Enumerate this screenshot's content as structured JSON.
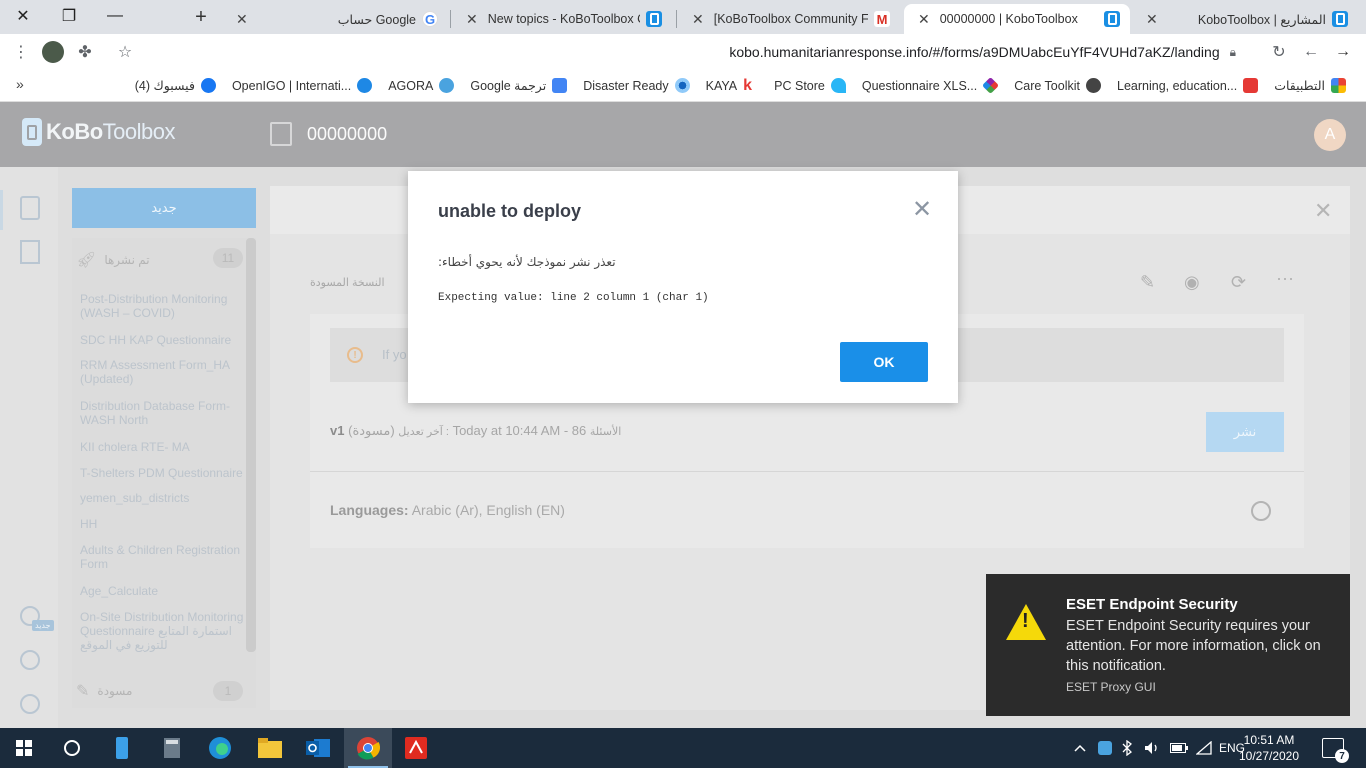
{
  "browser": {
    "tabs": [
      {
        "title": "حساب Google",
        "favicon": "google-icon"
      },
      {
        "title": "New topics - KoBoToolbox Con",
        "favicon": "kobo-icon"
      },
      {
        "title": "[KoBoToolbox Community Foru",
        "favicon": "gmail-icon"
      },
      {
        "title": "00000000 | KoboToolbox",
        "favicon": "kobo-icon",
        "active": true
      },
      {
        "title": "KoboToolbox | المشاريع",
        "favicon": "kobo-icon"
      }
    ],
    "url": "kobo.humanitarianresponse.info/#/forms/a9DMUabcEuYfF4VUHd7aKZ/landing",
    "bookmarks": [
      "التطبيقات",
      "Learning, education...",
      "Care Toolkit",
      "Questionnaire XLS...",
      "PC Store",
      "KAYA",
      "Disaster Ready",
      "Google ترجمة",
      "AGORA",
      "OpenIGO | Internati...",
      "(4) فيسبوك"
    ],
    "more_label": "»"
  },
  "app": {
    "logo_bold": "KoBo",
    "logo_light": "Toolbox",
    "form_title": "00000000",
    "user_initial": "A",
    "new_button": "جديد",
    "sidebar": {
      "deployed_header": "تم نشرها",
      "deployed_count": "11",
      "items": [
        "Post-Distribution Monitoring (WASH – COVID)",
        "SDC HH KAP Questionnaire",
        "RRM Assessment Form_HA (Updated)",
        "Distribution Database Form-WASH North",
        "KII cholera RTE- MA",
        "T-Shelters PDM Questionnaire",
        "yemen_sub_districts",
        "HH",
        "Adults & Children Registration Form",
        "Age_Calculate",
        "On-Site Distribution Monitoring Questionnaire استمارة المتابع للتوزيع في الموقع"
      ],
      "draft_header": "مسودة",
      "draft_count": "1",
      "help_badge": "جديد"
    },
    "main": {
      "draft_label": "النسخة المسودة",
      "warning_text": "If yo",
      "version": "v1",
      "version_status": "(مسودة)",
      "last_modified_label": "آخر تعديل :",
      "last_modified": "Today at 10:44 AM - 86",
      "questions_label": "الأسئلة",
      "deploy_button": "نشر",
      "languages_label": "Languages:",
      "languages": "Arabic (Ar), English (EN)"
    }
  },
  "modal": {
    "title": "unable to deploy",
    "message": "تعذر نشر نموذجك لأنه يحوي أخطاء:",
    "error": "Expecting value: line 2 column 1 (char 1)",
    "ok_button": "OK"
  },
  "toast": {
    "title": "ESET Endpoint Security",
    "body": "ESET Endpoint Security requires your attention. For more information, click on this notification.",
    "source": "ESET Proxy GUI"
  },
  "taskbar": {
    "language": "ENG",
    "time": "10:51 AM",
    "date": "10/27/2020",
    "notification_count": "7"
  },
  "colors": {
    "accent": "#1a8fe8",
    "header_gray": "#a7a7a9",
    "toast_bg": "#2b2b2b",
    "taskbar": "#1b2b3c",
    "warning_yellow": "#f5d90a"
  }
}
